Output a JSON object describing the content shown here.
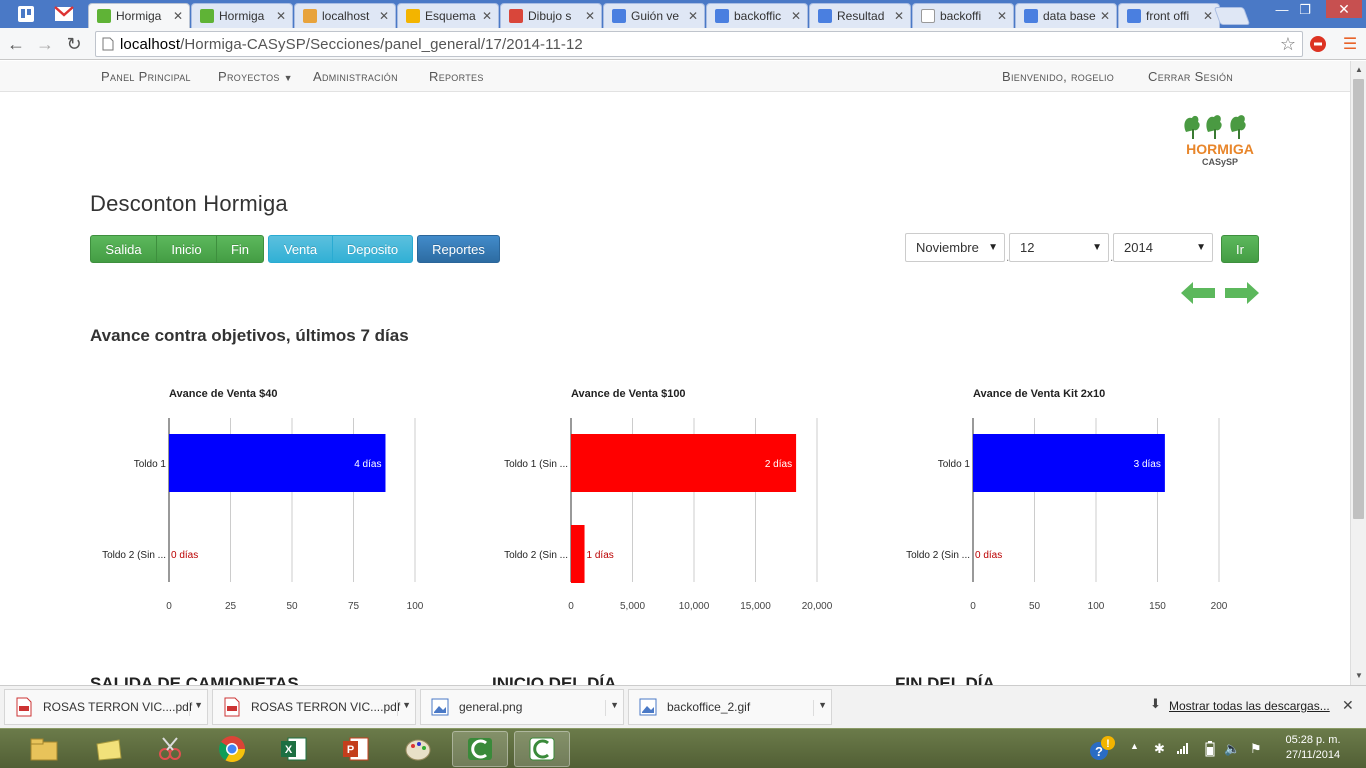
{
  "browser": {
    "tabs": [
      {
        "label": "Hormiga",
        "fav": "leaf-icon",
        "color": "#5fb336",
        "active": true
      },
      {
        "label": "Hormiga",
        "fav": "leaf-icon",
        "color": "#5fb336",
        "active": false
      },
      {
        "label": "localhost",
        "fav": "pma-icon",
        "color": "#e8a33c",
        "active": false
      },
      {
        "label": "Esquema",
        "fav": "drive-icon",
        "color": "#f3b400",
        "active": false
      },
      {
        "label": "Dibujo s",
        "fav": "drawing-icon",
        "color": "#d9463a",
        "active": false
      },
      {
        "label": "Guión ve",
        "fav": "docs-icon",
        "color": "#4a7fe0",
        "active": false
      },
      {
        "label": "backoffic",
        "fav": "google-icon",
        "color": "#4a7fe0",
        "active": false
      },
      {
        "label": "Resultad",
        "fav": "google-icon",
        "color": "#4a7fe0",
        "active": false
      },
      {
        "label": "backoffi",
        "fav": "page-icon",
        "color": "#ffffff",
        "active": false
      },
      {
        "label": "data base",
        "fav": "google-icon",
        "color": "#4a7fe0",
        "active": false
      },
      {
        "label": "front offi",
        "fav": "google-icon",
        "color": "#4a7fe0",
        "active": false
      }
    ],
    "url_host": "localhost",
    "url_path": "/Hormiga-CASySP/Secciones/panel_general/17/2014-11-12"
  },
  "nav": {
    "panel": "Panel Principal",
    "proyectos": "Proyectos",
    "administracion": "Administración",
    "reportes": "Reportes",
    "bienvenido": "Bienvenido, rogelio",
    "cerrar": "Cerrar Sesión"
  },
  "logo": {
    "line1": "HORMIGA",
    "line2": "CASySP"
  },
  "page": {
    "title": "Desconton Hormiga",
    "buttons": {
      "salida": "Salida",
      "inicio": "Inicio",
      "fin": "Fin",
      "venta": "Venta",
      "deposito": "Deposito",
      "reportes": "Reportes",
      "ir": "Ir"
    },
    "date": {
      "month": "Noviembre",
      "day": "12",
      "year": "2014"
    },
    "section_title": "Avance contra objetivos, últimos 7 días",
    "bottom": {
      "salida": "SALIDA DE CAMIONETAS",
      "inicio": "INICIO DEL DÍA",
      "fin": "FIN DEL DÍA"
    }
  },
  "chart_data": [
    {
      "type": "bar",
      "orientation": "horizontal",
      "title": "Avance de Venta $40",
      "categories": [
        "Toldo 1",
        "Toldo 2 (Sin ..."
      ],
      "values": [
        88,
        0
      ],
      "labels": [
        "4 días",
        "0 días"
      ],
      "xticks": [
        0,
        25,
        50,
        75,
        100
      ],
      "xlim": [
        0,
        100
      ],
      "color": "#0000ff",
      "grid": true
    },
    {
      "type": "bar",
      "orientation": "horizontal",
      "title": "Avance de Venta $100",
      "categories": [
        "Toldo 1 (Sin ...",
        "Toldo 2 (Sin ..."
      ],
      "values": [
        18300,
        1100
      ],
      "labels": [
        "2 días",
        "1 días"
      ],
      "xticks": [
        0,
        5000,
        10000,
        15000,
        20000
      ],
      "xlim": [
        0,
        20000
      ],
      "color": "#ff0000",
      "grid": true
    },
    {
      "type": "bar",
      "orientation": "horizontal",
      "title": "Avance de Venta Kit 2x10",
      "categories": [
        "Toldo 1",
        "Toldo 2 (Sin ..."
      ],
      "values": [
        156,
        0
      ],
      "labels": [
        "3 días",
        "0 días"
      ],
      "xticks": [
        0,
        50,
        100,
        150,
        200
      ],
      "xlim": [
        0,
        200
      ],
      "color": "#0000ff",
      "grid": true
    }
  ],
  "downloads": {
    "items": [
      {
        "name": "ROSAS TERRON VIC....pdf",
        "icon": "pdf-icon"
      },
      {
        "name": "ROSAS TERRON VIC....pdf",
        "icon": "pdf-icon"
      },
      {
        "name": "general.png",
        "icon": "image-icon"
      },
      {
        "name": "backoffice_2.gif",
        "icon": "image-icon"
      }
    ],
    "show_all": "Mostrar todas las descargas..."
  },
  "taskbar": {
    "time": "05:28 p. m.",
    "date": "27/11/2014"
  }
}
